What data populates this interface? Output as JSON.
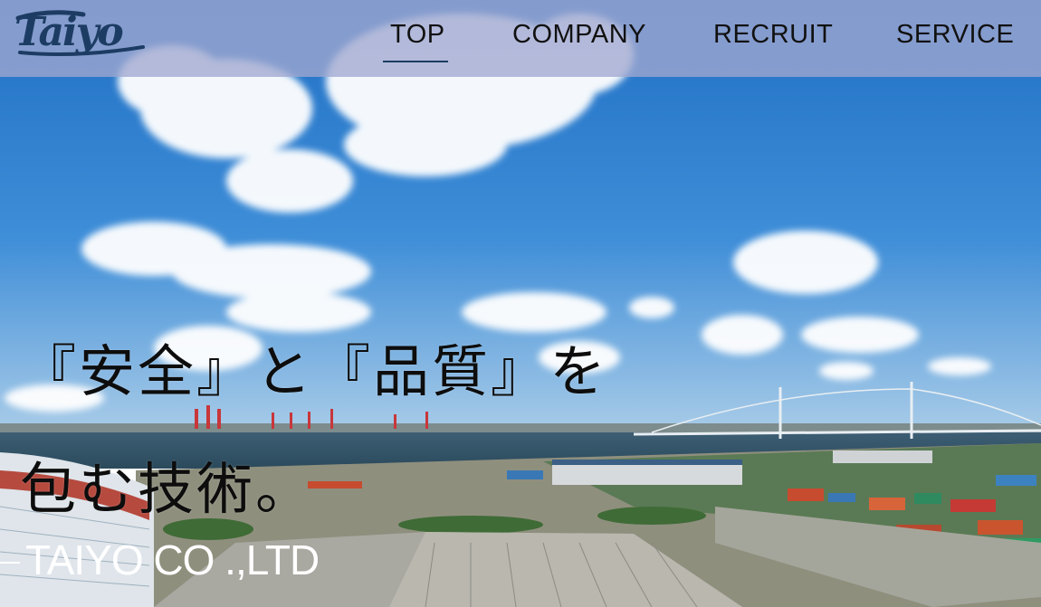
{
  "brand": {
    "logo_text": "Taiyo",
    "logo_color": "#1d3c63"
  },
  "nav": {
    "items": [
      {
        "label": "TOP",
        "active": true
      },
      {
        "label": "COMPANY",
        "active": false
      },
      {
        "label": "RECRUIT",
        "active": false
      },
      {
        "label": "SERVICE",
        "active": false
      }
    ],
    "background": "#a0a8d0"
  },
  "hero": {
    "headline_line1": "『安全』と『品質』を",
    "headline_line2": "包む技術。",
    "company_name": "TAIYO CO .,LTD",
    "image": "harbor-panorama"
  }
}
